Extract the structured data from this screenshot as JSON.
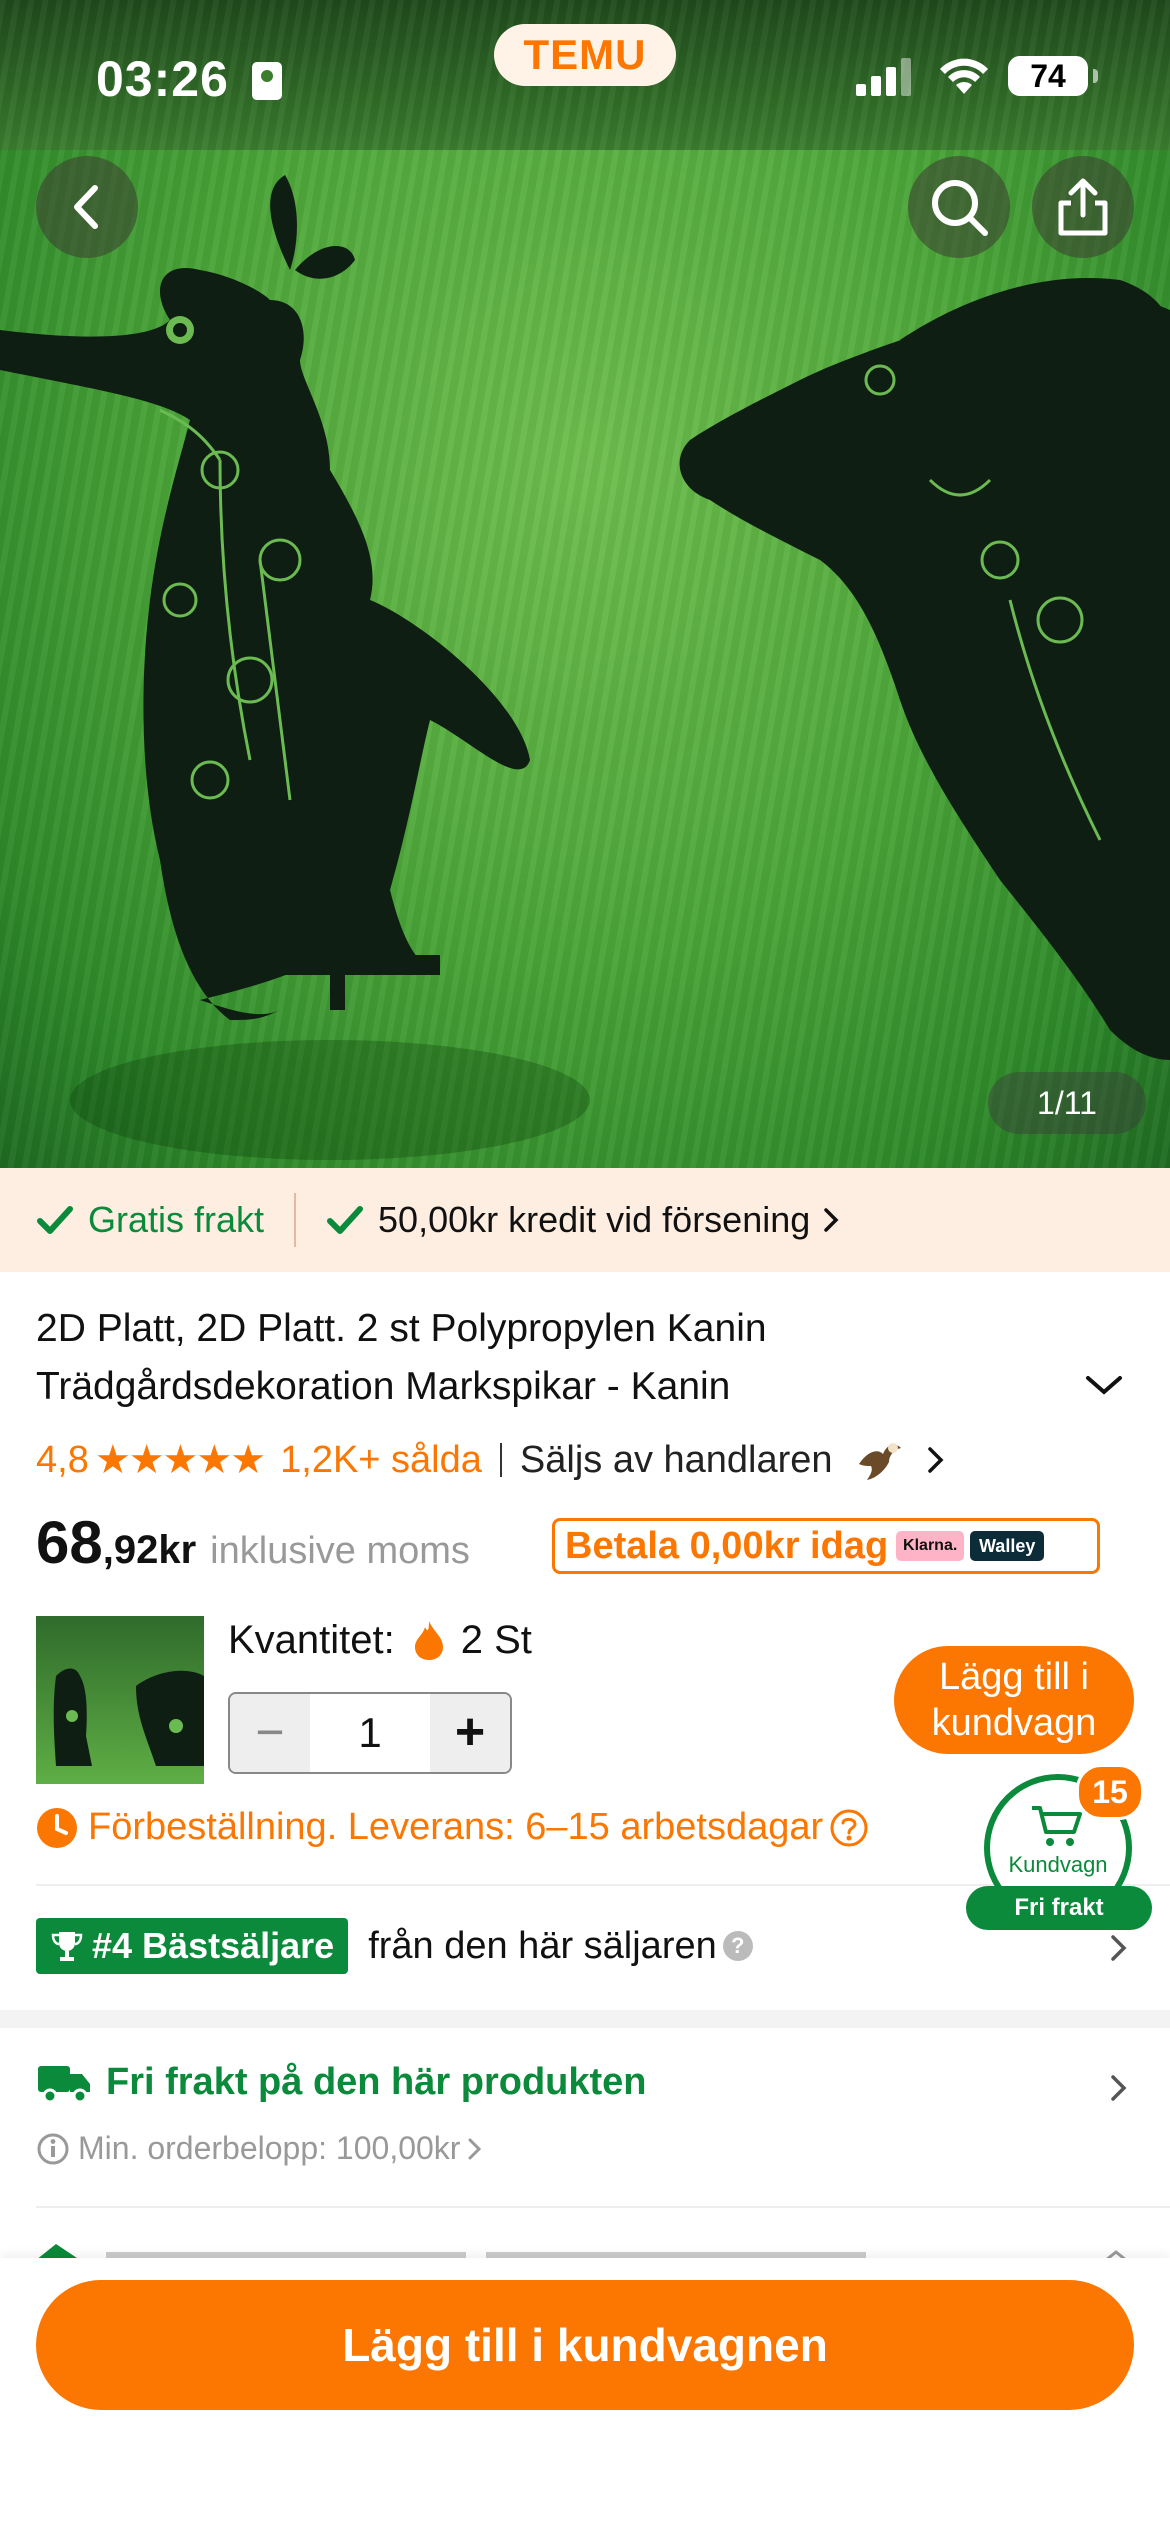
{
  "status_bar": {
    "time": "03:26",
    "battery": "74"
  },
  "brand": {
    "logo": "TEMU"
  },
  "gallery": {
    "counter": "1/11"
  },
  "promo": {
    "free_shipping": "Gratis frakt",
    "credit": "50,00kr kredit vid försening"
  },
  "product": {
    "title": "2D Platt, 2D Platt. 2 st Polypropylen Kanin Trädgårdsdekoration Markspikar - Kanin",
    "rating": "4,8",
    "stars": "★★★★★",
    "sold": "1,2K+ sålda",
    "seller_label": "Säljs av handlaren",
    "price_int": "68",
    "price_dec": ",92kr",
    "price_note": "inklusive moms",
    "pay_today": "Betala 0,00kr idag",
    "klarna": "Klarna.",
    "walley": "Walley"
  },
  "quantity": {
    "label": "Kvantitet:",
    "stock": "2 St",
    "value": "1",
    "add_to_cart": "Lägg till i kundvagn"
  },
  "preorder": {
    "text": "Förbeställning. Leverans: 6–15 arbetsdagar"
  },
  "cart_float": {
    "label": "Kundvagn",
    "count": "15",
    "free_shipping": "Fri frakt"
  },
  "bestseller": {
    "badge": "#4 Bästsäljare",
    "text": "från den här säljaren"
  },
  "shipping": {
    "title": "Fri frakt på den här produkten",
    "min_order": "Min. orderbelopp: 100,00kr"
  },
  "cta": {
    "label": "Lägg till i kundvagnen"
  },
  "colors": {
    "accent": "#fb7701",
    "green": "#0a8a3a",
    "promo_bg": "#fdeee1"
  }
}
